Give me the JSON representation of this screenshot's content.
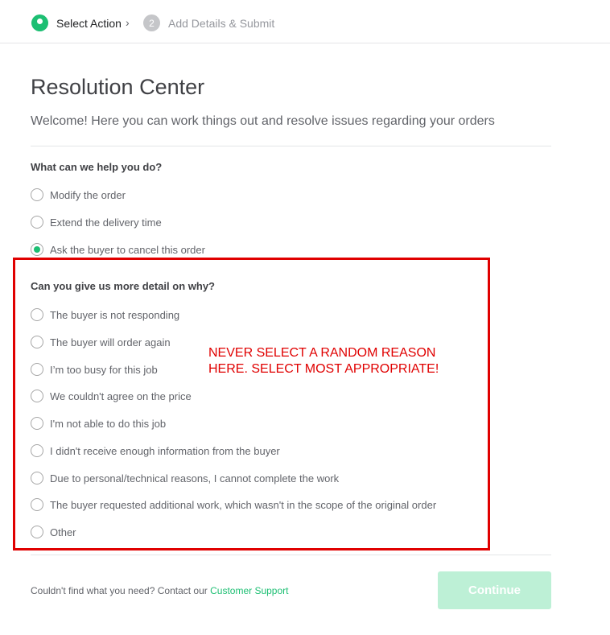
{
  "stepper": {
    "step1_label": "Select Action",
    "step2_number": "2",
    "step2_label": "Add Details & Submit",
    "separator": "›"
  },
  "page": {
    "title": "Resolution Center",
    "subtitle": "Welcome! Here you can work things out and resolve issues regarding your orders"
  },
  "action_question": {
    "label": "What can we help you do?",
    "options": [
      {
        "label": "Modify the order",
        "checked": false
      },
      {
        "label": "Extend the delivery time",
        "checked": false
      },
      {
        "label": "Ask the buyer to cancel this order",
        "checked": true
      }
    ]
  },
  "reason_question": {
    "label": "Can you give us more detail on why?",
    "options": [
      {
        "label": "The buyer is not responding",
        "checked": false
      },
      {
        "label": "The buyer will order again",
        "checked": false
      },
      {
        "label": "I’m too busy for this job",
        "checked": false
      },
      {
        "label": "We couldn't agree on the price",
        "checked": false
      },
      {
        "label": "I'm not able to do this job",
        "checked": false
      },
      {
        "label": "I didn't receive enough information from the buyer",
        "checked": false
      },
      {
        "label": "Due to personal/technical reasons, I cannot complete the work",
        "checked": false
      },
      {
        "label": "The buyer requested additional work, which wasn't in the scope of the original order",
        "checked": false
      },
      {
        "label": "Other",
        "checked": false
      }
    ]
  },
  "annotation": {
    "line1": "NEVER SELECT A RANDOM REASON",
    "line2": "HERE. SELECT MOST APPROPRIATE!",
    "color": "#e00000"
  },
  "footer": {
    "help_text": "Couldn't find what you need? Contact our ",
    "support_link": "Customer Support",
    "continue_label": "Continue"
  },
  "colors": {
    "accent": "#1dbf73",
    "continue_disabled": "#bdf0d6"
  }
}
